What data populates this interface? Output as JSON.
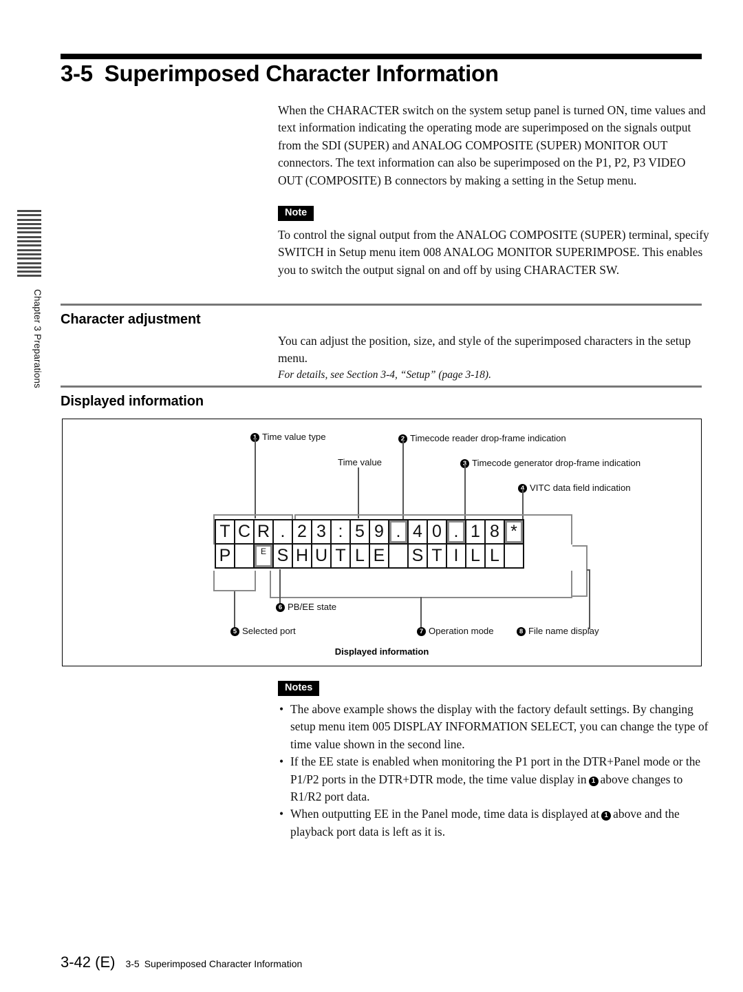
{
  "chapter_tab": {
    "label": "Chapter 3    Preparations",
    "stripe_count": 16
  },
  "heading": {
    "number": "3-5",
    "title": "Superimposed Character Information"
  },
  "intro": {
    "paragraph": "When the CHARACTER switch on the system setup panel is turned ON, time values and text information indicating the operating mode are superimposed on the signals output from the SDI (SUPER) and ANALOG COMPOSITE (SUPER) MONITOR OUT connectors. The text information can also be superimposed on the P1, P2, P3 VIDEO OUT (COMPOSITE) B connectors by making a setting in the Setup menu."
  },
  "note": {
    "badge": "Note",
    "text": "To control the signal output from the ANALOG COMPOSITE (SUPER) terminal, specify SWITCH in Setup menu item 008 ANALOG MONITOR SUPERIMPOSE. This enables you to switch the output signal on and off by using CHARACTER SW."
  },
  "character_adjustment": {
    "title": "Character adjustment",
    "text": "You can adjust the position, size, and style of the superimposed characters in the setup menu.",
    "reference": "For details, see Section 3-4, “Setup” (page 3-18)."
  },
  "displayed_information": {
    "title": "Displayed information",
    "figure_caption": "Displayed information",
    "display_rows": [
      [
        "T",
        "C",
        "R",
        ".",
        "2",
        "3",
        ":",
        "5",
        "9",
        ".",
        "4",
        "0",
        ".",
        "1",
        "8",
        "*"
      ],
      [
        "P",
        "",
        "E",
        "S",
        "H",
        "U",
        "T",
        "L",
        "E",
        "",
        "S",
        "T",
        "I",
        "L",
        "L",
        ""
      ]
    ],
    "callouts": [
      {
        "num": "1",
        "label": "Time value type"
      },
      {
        "num": "2",
        "label": "Timecode reader drop-frame indication"
      },
      {
        "num": "3",
        "label": "Timecode generator drop-frame indication"
      },
      {
        "num": "4",
        "label": "VITC data field indication"
      },
      {
        "num": "5",
        "label": "Selected port"
      },
      {
        "num": "6",
        "label": "PB/EE state"
      },
      {
        "num": "7",
        "label": "Operation mode"
      },
      {
        "num": "8",
        "label": "File name display"
      }
    ],
    "plain_label": "Time value"
  },
  "notes": {
    "badge": "Notes",
    "bullet": "•",
    "items": [
      {
        "part1": "The above example shows the display with the factory default settings. By changing setup menu item 005 DISPLAY INFORMATION SELECT, you can change the type of time value shown in the second line.",
        "ref": "",
        "part2": ""
      },
      {
        "part1": "If the EE state is enabled when monitoring the P1 port in the DTR+Panel mode or the P1/P2 ports in the DTR+DTR mode, the time value display in",
        "ref": "1",
        "part2": "above changes to R1/R2 port data."
      },
      {
        "part1": "When outputting EE in the Panel mode, time data is displayed at",
        "ref": "1",
        "part2": "above and the playback port data is left as it is."
      }
    ]
  },
  "footer": {
    "page": "3-42 (E)",
    "section_number": "3-5",
    "section_title": "Superimposed Character Information"
  }
}
